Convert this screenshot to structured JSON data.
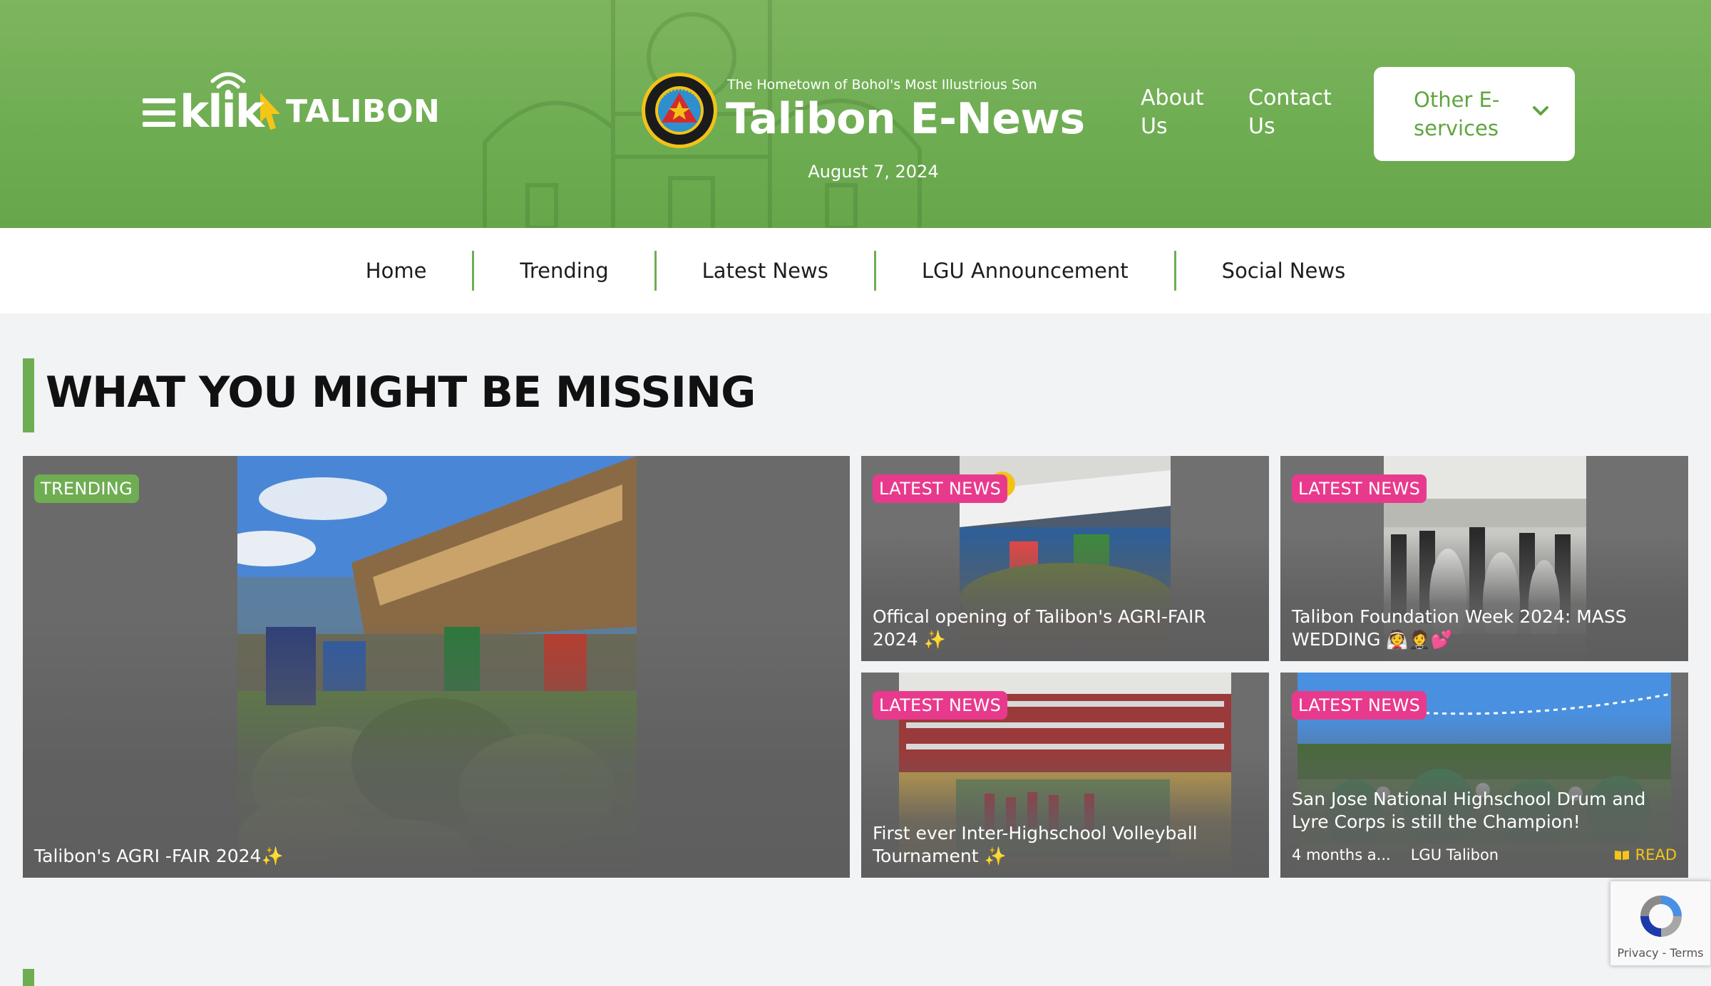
{
  "header": {
    "logo_klik": "klik",
    "logo_town": "TALIBON",
    "tagline": "The Hometown of Bohol's Most Illustrious Son",
    "site_title": "Talibon E-News",
    "date": "August 7, 2024",
    "about_link": "About Us",
    "contact_link": "Contact Us",
    "services_dropdown": "Other E-services",
    "seal_text": "MUNICIPALITY OF TALIBON • PROVINCE OF BOHOL",
    "brand_color": "#6fad53"
  },
  "nav": {
    "items": [
      {
        "label": "Home"
      },
      {
        "label": "Trending"
      },
      {
        "label": "Latest News"
      },
      {
        "label": "LGU Announcement"
      },
      {
        "label": "Social News"
      }
    ]
  },
  "section": {
    "title": "WHAT YOU MIGHT BE MISSING"
  },
  "cards": [
    {
      "badge": "TRENDING",
      "title": "Talibon's AGRI -FAIR 2024✨",
      "badge_color": "#6fad53"
    },
    {
      "badge": "LATEST NEWS",
      "title": "Offical opening of Talibon's AGRI-FAIR 2024 ✨",
      "badge_color": "#e83a8c"
    },
    {
      "badge": "LATEST NEWS",
      "title": "Talibon Foundation Week 2024: MASS WEDDING 👰🤵💕",
      "badge_color": "#e83a8c"
    },
    {
      "badge": "LATEST NEWS",
      "title": "First ever Inter-Highschool Volleyball Tournament ✨",
      "badge_color": "#e83a8c"
    },
    {
      "badge": "LATEST NEWS",
      "title": "San Jose National Highschool Drum and Lyre Corps is still the Champion!",
      "badge_color": "#e83a8c",
      "time": "4 months a...",
      "author": "LGU Talibon",
      "read": "READ"
    }
  ],
  "recaptcha": {
    "privacy": "Privacy",
    "sep": " - ",
    "terms": "Terms"
  }
}
